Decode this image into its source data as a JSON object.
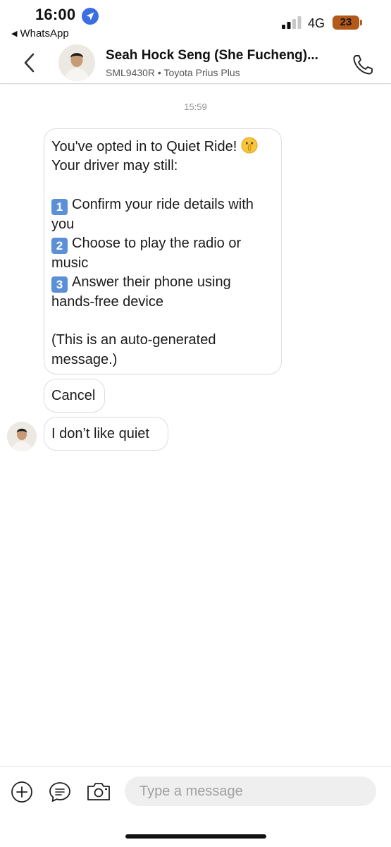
{
  "status_bar": {
    "time": "16:00",
    "back_app": "WhatsApp",
    "network": "4G",
    "battery": "23",
    "colors": {
      "location_badge": "#3b6ee0",
      "battery": "#b35a1a"
    }
  },
  "header": {
    "contact_name": "Seah Hock Seng (She Fucheng)...",
    "vehicle_info": "SML9430R • Toyota Prius Plus",
    "icons": [
      "back-chevron-icon",
      "avatar",
      "phone-icon"
    ]
  },
  "chat": {
    "timestamp": "15:59",
    "system_message": {
      "line1": "You've opted in to Quiet Ride!",
      "line1_emoji": "shushing-face-emoji",
      "line2": "Your driver may still:",
      "items": [
        {
          "keycap": "1",
          "text": "Confirm your ride details with you"
        },
        {
          "keycap": "2",
          "text": "Choose to play the radio or music"
        },
        {
          "keycap": "3",
          "text": "Answer their phone using hands-free device"
        }
      ],
      "footer": "(This is an auto-generated message.)"
    },
    "messages": [
      {
        "text": "Cancel"
      },
      {
        "text": "I don’t like quiet"
      }
    ],
    "colors": {
      "keycap": "#5b8fd6",
      "bubble_border": "#dcdcdc"
    }
  },
  "composer": {
    "placeholder": "Type a message",
    "icons": [
      "plus-circle-icon",
      "quick-reply-icon",
      "camera-icon"
    ]
  }
}
